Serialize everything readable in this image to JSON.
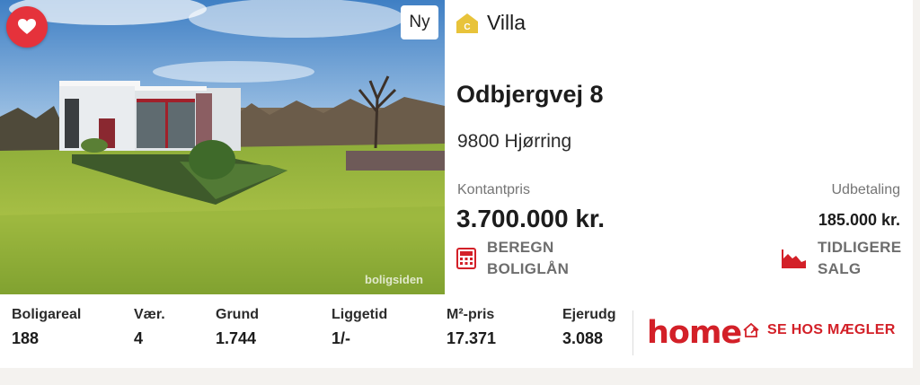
{
  "listing": {
    "new_badge": "Ny",
    "photo_watermark": "boligsiden",
    "type": {
      "icon": "villa-house-icon",
      "icon_letter": "C",
      "label": "Villa"
    },
    "address": "Odbjergvej 8",
    "city": "9800 Hjørring",
    "price_label": "Kontantpris",
    "price": "3.700.000 kr.",
    "down_payment_label": "Udbetaling",
    "down_payment": "185.000 kr.",
    "actions": {
      "calc_line1": "BEREGN",
      "calc_line2": "BOLIGLÅN",
      "history_line1": "TIDLIGERE",
      "history_line2": "SALG"
    }
  },
  "stats": [
    {
      "label": "Boligareal",
      "value": "188"
    },
    {
      "label": "Vær.",
      "value": "4"
    },
    {
      "label": "Grund",
      "value": "1.744"
    },
    {
      "label": "Liggetid",
      "value": "1/-"
    },
    {
      "label": "M²-pris",
      "value": "17.371"
    },
    {
      "label": "Ejerudg",
      "value": "3.088"
    }
  ],
  "broker": {
    "logo_text": "home",
    "cta": "SE HOS MÆGLER"
  },
  "colors": {
    "accent_red": "#e5323b",
    "brand_red": "#d32028",
    "villa_icon": "#e8c33a",
    "muted_text": "#757575"
  }
}
